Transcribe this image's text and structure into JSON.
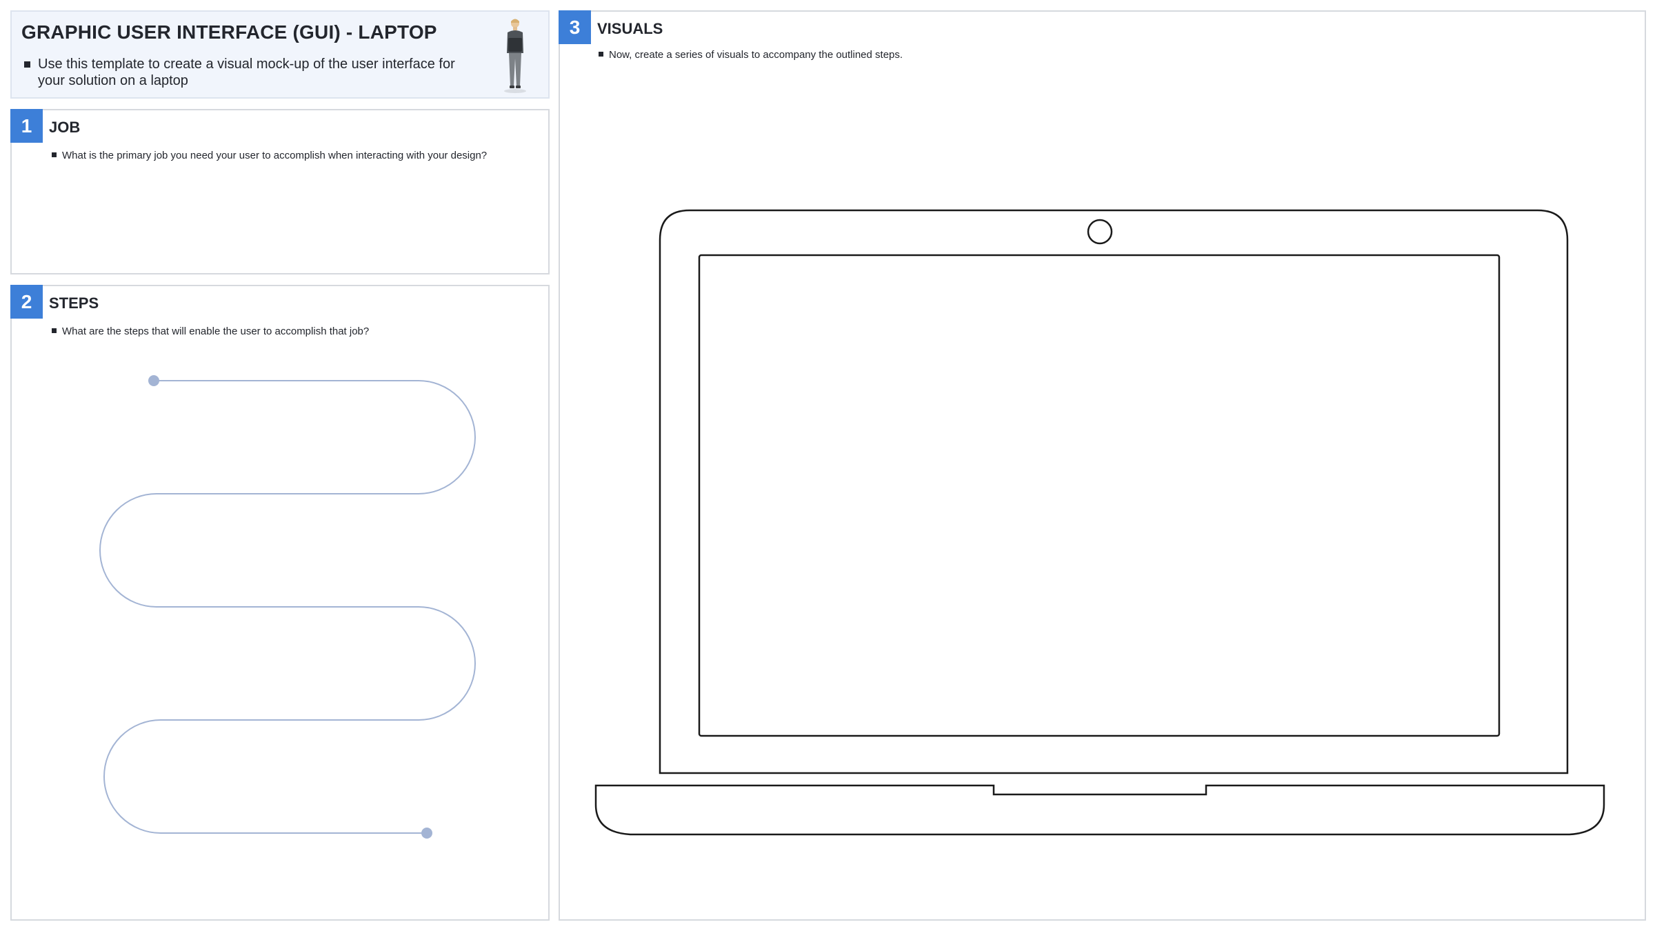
{
  "header": {
    "title": "GRAPHIC USER INTERFACE (GUI) - LAPTOP",
    "intro": "Use this template to create a visual mock-up of the user interface for your solution on a laptop"
  },
  "sections": {
    "job": {
      "number": "1",
      "title": "JOB",
      "prompt": "What is the primary job you need your user to accomplish when interacting with your design?"
    },
    "steps": {
      "number": "2",
      "title": "STEPS",
      "prompt": "What are the steps that will enable the user to accomplish that job?"
    },
    "visuals": {
      "number": "3",
      "title": "VISUALS",
      "prompt": "Now, create a series of visuals to accompany the outlined steps."
    }
  },
  "colors": {
    "accent": "#3d7fd8",
    "path_line": "#a3b4d4",
    "title_panel_bg": "#f1f5fc",
    "panel_border": "#d6d9de",
    "text": "#23262d"
  },
  "icons": {
    "figure": "person-holding-laptop-icon",
    "bullet": "square-bullet-icon",
    "laptop": "laptop-outline-icon"
  }
}
